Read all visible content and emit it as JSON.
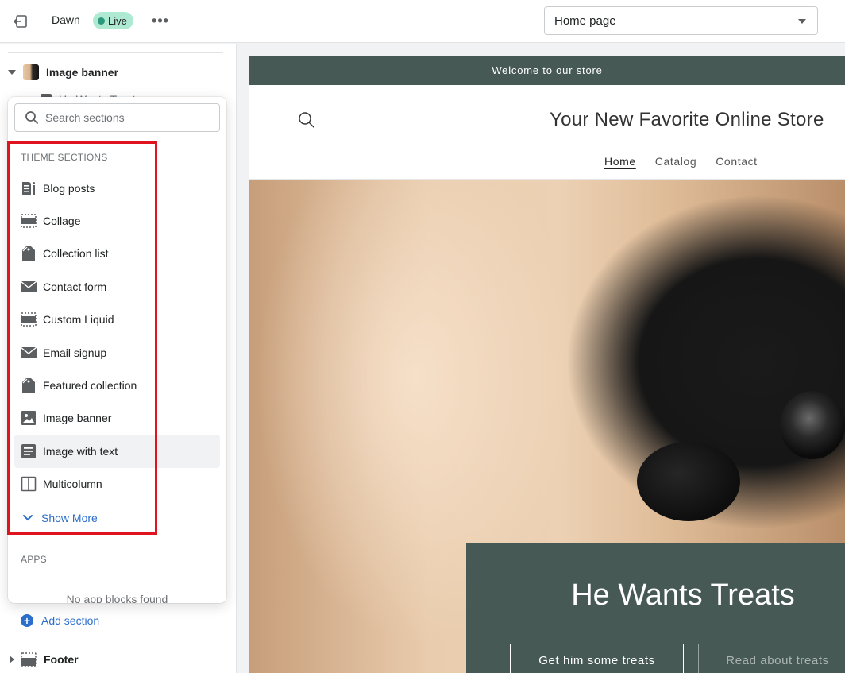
{
  "topbar": {
    "theme_name": "Dawn",
    "status_badge": "Live",
    "more_label": "•••",
    "page_select": "Home page"
  },
  "sidebar": {
    "sections": [
      {
        "label": "Image banner",
        "expanded": true
      },
      {
        "label": "Footer",
        "expanded": false
      }
    ],
    "child_partial": "He Wants Treat",
    "add_section": "Add section"
  },
  "popover": {
    "search_placeholder": "Search sections",
    "theme_sections_heading": "THEME SECTIONS",
    "items": [
      {
        "label": "Blog posts",
        "icon": "blog-icon"
      },
      {
        "label": "Collage",
        "icon": "collage-icon"
      },
      {
        "label": "Collection list",
        "icon": "tag-icon"
      },
      {
        "label": "Contact form",
        "icon": "envelope-icon"
      },
      {
        "label": "Custom Liquid",
        "icon": "collage-icon"
      },
      {
        "label": "Email signup",
        "icon": "envelope-icon"
      },
      {
        "label": "Featured collection",
        "icon": "tag-icon"
      },
      {
        "label": "Image banner",
        "icon": "image-icon"
      },
      {
        "label": "Image with text",
        "icon": "text-block-icon"
      },
      {
        "label": "Multicolumn",
        "icon": "columns-icon"
      }
    ],
    "show_more": "Show More",
    "apps_heading": "APPS",
    "no_apps": "No app blocks found"
  },
  "preview": {
    "announcement": "Welcome to our store",
    "store_title": "Your New Favorite Online Store",
    "nav": [
      "Home",
      "Catalog",
      "Contact"
    ],
    "hero_heading": "He Wants Treats",
    "hero_button_primary": "Get him some treats",
    "hero_button_secondary": "Read about treats"
  },
  "colors": {
    "accent_blue": "#2c6ecb",
    "live_badge": "#aee9d1",
    "store_green": "#465955",
    "highlight_red": "#e0141e"
  }
}
